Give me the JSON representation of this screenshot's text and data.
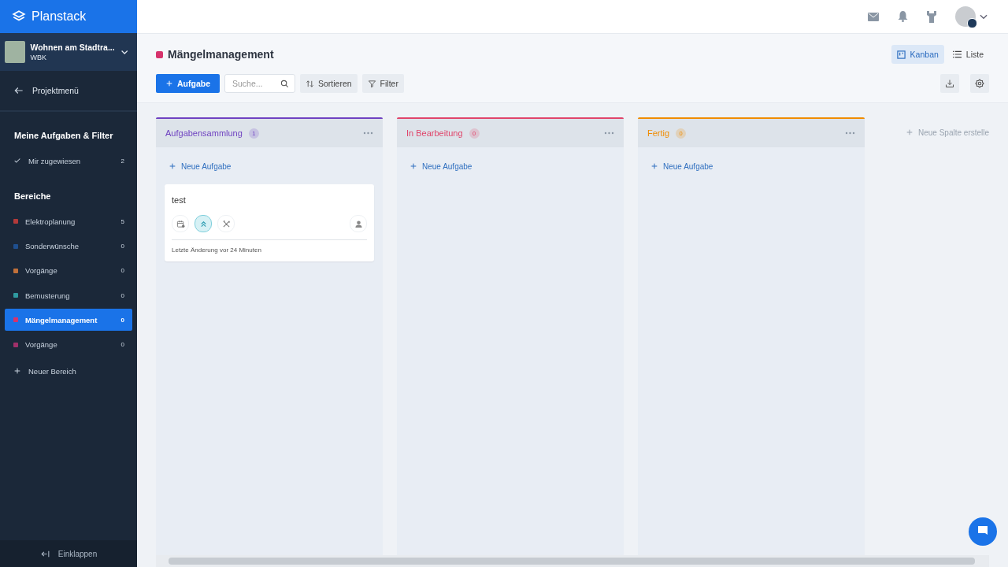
{
  "brand": {
    "name": "Planstack"
  },
  "project": {
    "name": "Wohnen am Stadtra...",
    "company": "WBK"
  },
  "back_link": "Projektmenü",
  "my_tasks": {
    "heading": "Meine Aufgaben & Filter",
    "items": [
      {
        "label": "Mir zugewiesen",
        "count": "2"
      }
    ]
  },
  "areas": {
    "heading": "Bereiche",
    "items": [
      {
        "label": "Elektroplanung",
        "count": "5",
        "color": "#b33a3a",
        "selected": false
      },
      {
        "label": "Sonderwünsche",
        "count": "0",
        "color": "#1f4f8f",
        "selected": false
      },
      {
        "label": "Vorgänge",
        "count": "0",
        "color": "#c0703a",
        "selected": false
      },
      {
        "label": "Bemusterung",
        "count": "0",
        "color": "#2f9aa0",
        "selected": false
      },
      {
        "label": "Mängelmanagement",
        "count": "0",
        "color": "#d6336c",
        "selected": true
      },
      {
        "label": "Vorgänge",
        "count": "0",
        "color": "#a0306a",
        "selected": false
      }
    ],
    "add_label": "Neuer Bereich"
  },
  "collapse_label": "Einklappen",
  "page": {
    "title": "Mängelmanagement",
    "color": "#d6336c"
  },
  "view_tabs": [
    {
      "label": "Kanban",
      "selected": true
    },
    {
      "label": "Liste",
      "selected": false
    }
  ],
  "toolbar": {
    "add_button": "Aufgabe",
    "search": {
      "placeholder": "Suche..."
    },
    "sort_button": "Sortieren",
    "filter_button": "Filter"
  },
  "columns": [
    {
      "title": "Aufgabensammlung",
      "count": "1",
      "color": "#6f42c1",
      "add_label": "Neue Aufgabe",
      "cards": [
        {
          "title": "test",
          "footer": "Letzte Änderung vor 24 Minuten"
        }
      ]
    },
    {
      "title": "In Bearbeitung",
      "count": "0",
      "color": "#e0446a",
      "add_label": "Neue Aufgabe"
    },
    {
      "title": "Fertig",
      "count": "0",
      "color": "#f08c00",
      "add_label": "Neue Aufgabe"
    }
  ],
  "new_column_label": "Neue Spalte erstelle"
}
